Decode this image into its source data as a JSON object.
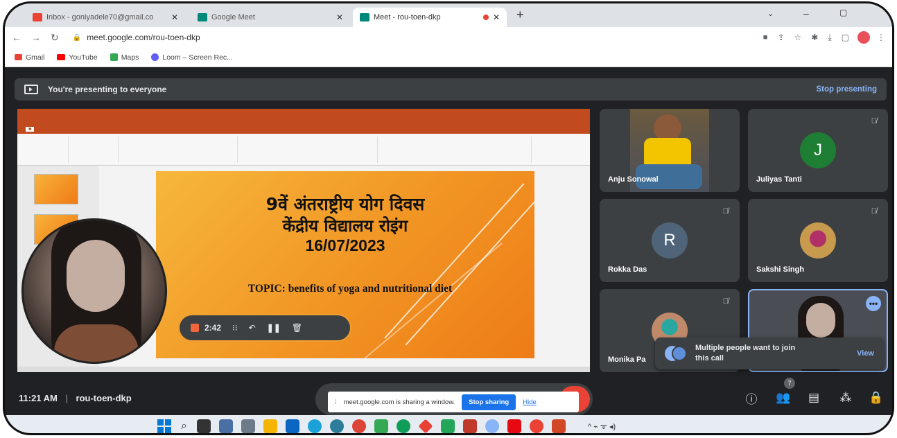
{
  "browser": {
    "tabs": [
      {
        "label": "Inbox - goniyadele70@gmail.co"
      },
      {
        "label": "Google Meet"
      },
      {
        "label": "Meet - rou-toen-dkp"
      }
    ],
    "url": "meet.google.com/rou-toen-dkp",
    "bookmarks": [
      "Gmail",
      "YouTube",
      "Maps",
      "Loom – Screen Rec..."
    ]
  },
  "meet": {
    "presenting_text": "You're presenting to everyone",
    "stop_presenting": "Stop presenting",
    "time": "11:21 AM",
    "meeting_code": "rou-toen-dkp",
    "participant_count": "7",
    "sharing_text": "meet.google.com is sharing a window.",
    "stop_sharing": "Stop sharing",
    "hide": "Hide"
  },
  "slide": {
    "line1": "9वें अंतराष्ट्रीय योग दिवस",
    "line2": "केंद्रीय विद्यालय रोइंग",
    "line3": "16/07/2023",
    "topic": "TOPIC: benefits of yoga and nutritional diet",
    "recording_time": "2:42"
  },
  "participants": [
    {
      "name": "Anju Sonowal",
      "initial": ""
    },
    {
      "name": "Juliyas Tanti",
      "initial": "J"
    },
    {
      "name": "Rokka Das",
      "initial": "R"
    },
    {
      "name": "Sakshi Singh",
      "initial": ""
    },
    {
      "name": "Monika Pa",
      "initial": ""
    }
  ],
  "notification": {
    "text": "Multiple people want to join this call",
    "action": "View"
  },
  "colors": {
    "accent": "#8ab4f8",
    "slide_orange": "#f19424",
    "record_red": "#ea4335"
  }
}
